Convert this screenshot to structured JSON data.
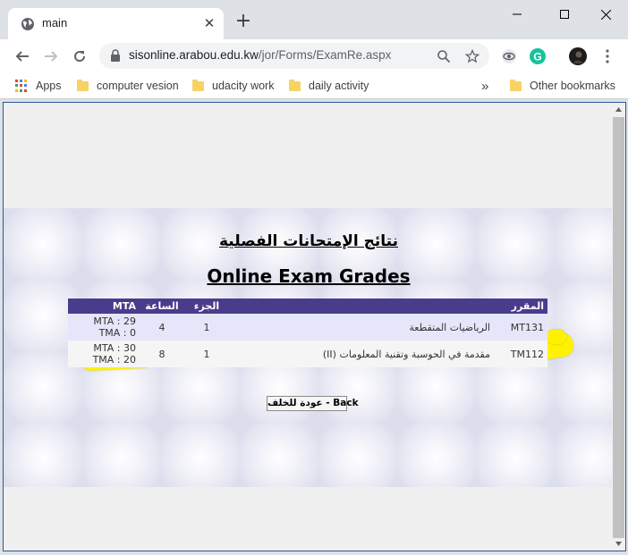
{
  "browser": {
    "tab_title": "main",
    "new_tab_symbol": "+",
    "close_symbol": "✕",
    "url_domain": "sisonline.arabou.edu.kw",
    "url_path": "/jor/Forms/ExamRe.aspx",
    "profile_badge": "G"
  },
  "bookmarks": {
    "apps_label": "Apps",
    "items": [
      "computer vesion",
      "udacity work",
      "daily activity"
    ],
    "overflow_symbol": "»",
    "other_label": "Other bookmarks"
  },
  "page": {
    "title_ar": "نتائج الإمتحانات الفصلية",
    "title_en": "Online Exam Grades",
    "table": {
      "headers": {
        "course": "المقرر",
        "name": "",
        "part": "الجزء",
        "hours": "الساعة",
        "mta": "MTA"
      },
      "rows": [
        {
          "course": "MT131",
          "name": "الرياضيات المتقطعة",
          "part": "1",
          "hours": "4",
          "mta": "MTA : 29\nTMA : 0"
        },
        {
          "course": "TM112",
          "name": "مقدمة في الحوسبة وتقنية المعلومات (II)",
          "part": "1",
          "hours": "8",
          "mta": "MTA : 30\nTMA : 20"
        }
      ]
    },
    "back_label": "عودة للخلف - Back"
  },
  "colors": {
    "header_bg": "#4a3c8c",
    "highlight": "#fff200",
    "row_a": "#e6e6fa",
    "row_b": "#f5f5f5"
  }
}
